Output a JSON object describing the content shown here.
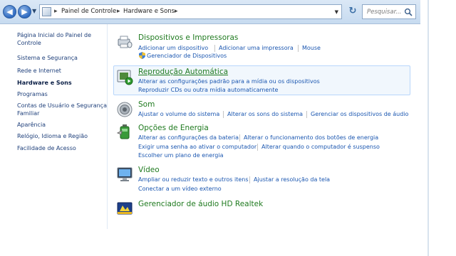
{
  "address_bar": {
    "crumbs": [
      "Painel de Controle",
      "Hardware e Sons"
    ],
    "search_placeholder": "Pesquisar..."
  },
  "sidebar": {
    "items": [
      {
        "label": "Página Inicial do Painel de"
      },
      {
        "label": "Controle"
      },
      {
        "label": "Sistema e Segurança"
      },
      {
        "label": "Rede e Internet"
      },
      {
        "label": "Hardware e Sons"
      },
      {
        "label": "Programas"
      },
      {
        "label": "Contas de Usuário e Segurança"
      },
      {
        "label": "Familiar"
      },
      {
        "label": "Aparência"
      },
      {
        "label": "Relógio, Idioma e Região"
      },
      {
        "label": "Facilidade de Acesso"
      }
    ]
  },
  "categories": {
    "devices": {
      "title": "Dispositivos e Impressoras",
      "links": [
        "Adicionar um dispositivo",
        "Adicionar uma impressora",
        "Mouse",
        "Gerenciador de Dispositivos"
      ],
      "icon": "devices-printers-icon"
    },
    "autoplay": {
      "title": "Reprodução Automática",
      "links": [
        "Alterar as configurações padrão para a mídia ou os dispositivos",
        "Reproduzir CDs ou outra mídia automaticamente"
      ],
      "icon": "autoplay-icon"
    },
    "sound": {
      "title": "Som",
      "links": [
        "Ajustar o volume do sistema",
        "Alterar os sons do sistema",
        "Gerenciar os dispositivos de áudio"
      ],
      "icon": "speaker-icon"
    },
    "power": {
      "title": "Opções de Energia",
      "links": [
        "Alterar as configurações da bateria",
        "Alterar o funcionamento dos botões de energia",
        "Exigir uma senha ao ativar o computador",
        "Alterar quando o computador é suspenso",
        "Escolher um plano de energia"
      ],
      "icon": "battery-power-icon"
    },
    "video": {
      "title": "Vídeo",
      "links": [
        "Ampliar ou reduzir texto e outros itens",
        "Ajustar a resolução da tela",
        "Conectar a um vídeo externo"
      ],
      "icon": "monitor-icon"
    },
    "realtek": {
      "title": "Gerenciador de áudio HD Realtek",
      "icon": "realtek-audio-icon"
    }
  }
}
